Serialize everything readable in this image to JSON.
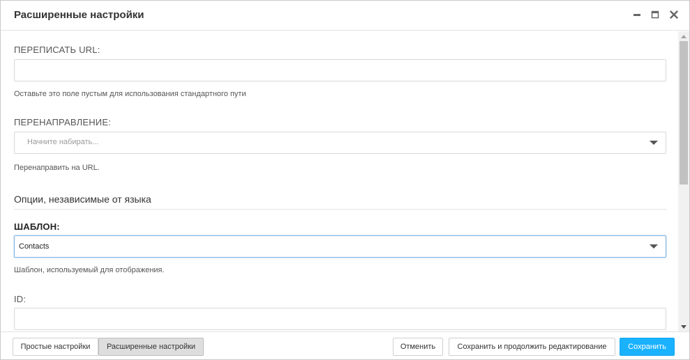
{
  "dialog": {
    "title": "Расширенные настройки"
  },
  "fields": {
    "rewrite_url": {
      "label": "ПЕРЕПИСАТЬ URL:",
      "value": "",
      "help": "Оставьте это поле пустым для использования стандартного пути"
    },
    "redirect": {
      "label": "ПЕРЕНАПРАВЛЕНИЕ:",
      "placeholder": "Начните набирать...",
      "help": "Перенаправить на URL."
    },
    "section": {
      "title": "Опции, независимые от языка"
    },
    "template": {
      "label": "ШАБЛОН:",
      "value": "Contacts",
      "help": "Шаблон, используемый для отображения."
    },
    "id": {
      "label": "ID:",
      "value": ""
    }
  },
  "footer": {
    "simple_settings": "Простые настройки",
    "advanced_settings": "Расширенные настройки",
    "cancel": "Отменить",
    "save_continue": "Сохранить и продолжить редактирование",
    "save": "Сохранить"
  },
  "icons": {
    "minimize": "minimize-icon",
    "maximize": "maximize-icon",
    "close": "close-icon",
    "dropdown": "chevron-down-icon"
  },
  "colors": {
    "primary": "#1ab2ff",
    "active_tab": "#dedede",
    "focus_border": "#7fb2e5"
  }
}
